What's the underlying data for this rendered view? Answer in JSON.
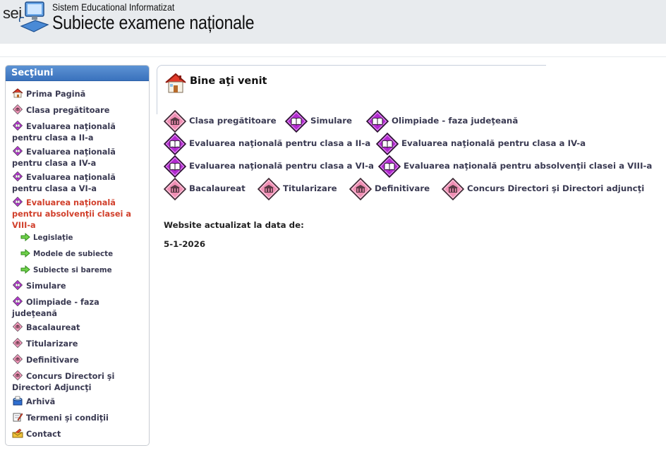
{
  "header": {
    "logo_short": "sei",
    "subtitle": "Sistem Educational Informatizat",
    "title": "Subiecte examene naționale"
  },
  "sidebar": {
    "title": "Secţiuni",
    "items": [
      {
        "label": "Prima Pagină",
        "icon": "home-icon"
      },
      {
        "label": "Clasa pregătitoare",
        "icon": "diamond-pink-icon"
      },
      {
        "label": "Evaluarea naţională pentru clasa a II-a",
        "icon": "diamond-purple-icon"
      },
      {
        "label": "Evaluarea naţională pentru clasa a IV-a",
        "icon": "diamond-purple-icon"
      },
      {
        "label": "Evaluarea naţională pentru clasa a VI-a",
        "icon": "diamond-purple-icon"
      },
      {
        "label": "Evaluarea naţională pentru absolvenţii clasei a VIII-a",
        "icon": "diamond-purple-icon",
        "active": true
      },
      {
        "label": "Simulare",
        "icon": "diamond-purple-icon"
      },
      {
        "label": "Olimpiade - faza judeţeană",
        "icon": "diamond-purple-icon"
      },
      {
        "label": "Bacalaureat",
        "icon": "diamond-pink-icon"
      },
      {
        "label": "Titularizare",
        "icon": "diamond-pink-icon"
      },
      {
        "label": "Definitivare",
        "icon": "diamond-pink-icon"
      },
      {
        "label": "Concurs Directori şi Directori Adjuncţi",
        "icon": "diamond-pink-icon"
      },
      {
        "label": "Arhivă",
        "icon": "archive-icon"
      },
      {
        "label": "Termeni şi condiţii",
        "icon": "notepad-icon"
      },
      {
        "label": "Contact",
        "icon": "contact-icon"
      }
    ],
    "subitems": [
      {
        "label": "Legislaţie",
        "icon": "arrow-right-icon"
      },
      {
        "label": "Modele de subiecte",
        "icon": "arrow-right-icon"
      },
      {
        "label": "Subiecte si bareme",
        "icon": "arrow-right-icon"
      }
    ]
  },
  "main": {
    "welcome": "Bine aţi venit",
    "links": [
      {
        "label": "Clasa pregătitoare",
        "icon": "diamond-pink-icon"
      },
      {
        "label": "Simulare",
        "icon": "diamond-purple-icon"
      },
      {
        "label": "Olimpiade - faza judeţeană",
        "icon": "diamond-purple-icon"
      },
      {
        "label": "Evaluarea naţională pentru clasa a II-a",
        "icon": "diamond-purple-icon"
      },
      {
        "label": "Evaluarea naţională pentru clasa a IV-a",
        "icon": "diamond-purple-icon"
      },
      {
        "label": "Evaluarea naţională pentru clasa a VI-a",
        "icon": "diamond-purple-icon"
      },
      {
        "label": "Evaluarea naţională pentru absolvenţii clasei a VIII-a",
        "icon": "diamond-purple-icon"
      },
      {
        "label": "Bacalaureat",
        "icon": "diamond-pink-icon"
      },
      {
        "label": "Titularizare",
        "icon": "diamond-pink-icon"
      },
      {
        "label": "Definitivare",
        "icon": "diamond-pink-icon"
      },
      {
        "label": "Concurs Directori şi Directori adjuncţi",
        "icon": "diamond-pink-icon"
      }
    ],
    "update_label": "Website actualizat la data de:",
    "update_date": "5-1-2026"
  },
  "colors": {
    "accent_blue": "#3a72bd",
    "active_red": "#d1402c",
    "diamond_pink": "#f08fb4",
    "diamond_purple": "#b32ad0",
    "link_text": "#3a3a52"
  }
}
